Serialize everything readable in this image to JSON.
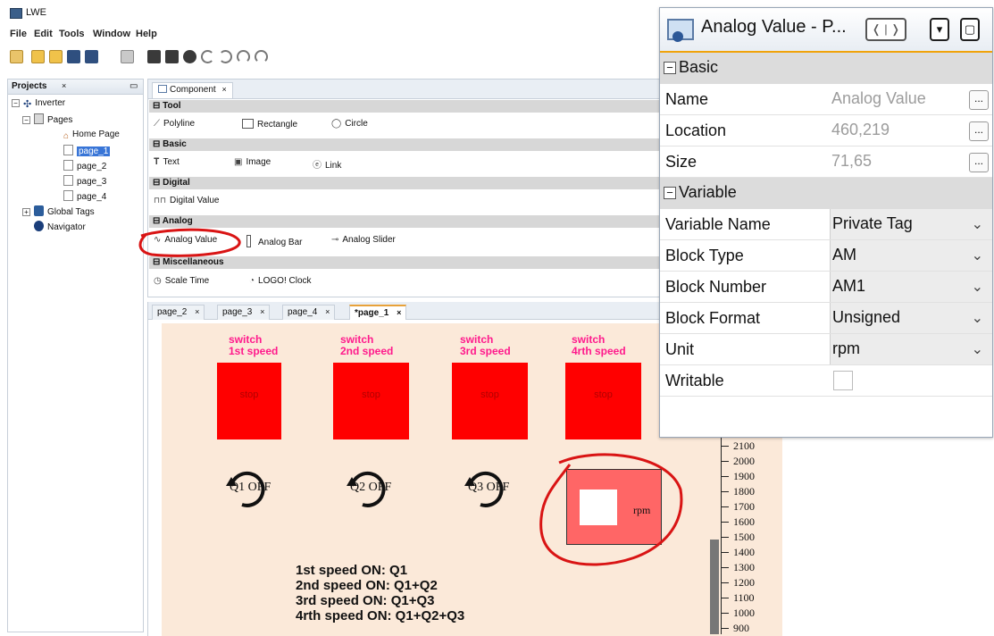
{
  "app": {
    "title": "LWE"
  },
  "menu": [
    "File",
    "Edit",
    "Tools",
    "Window",
    "Help"
  ],
  "projects": {
    "tab_label": "Projects",
    "tree": {
      "root": "Inverter",
      "pages_label": "Pages",
      "home": "Home Page",
      "pages": [
        "page_1",
        "page_2",
        "page_3",
        "page_4"
      ],
      "global_tags": "Global Tags",
      "navigator": "Navigator"
    }
  },
  "component": {
    "tab_label": "Component",
    "sections": {
      "tool": "Tool",
      "basic": "Basic",
      "digital": "Digital",
      "analog": "Analog",
      "misc": "Miscellaneous"
    },
    "items": {
      "polyline": "Polyline",
      "rectangle": "Rectangle",
      "circle": "Circle",
      "text": "Text",
      "image": "Image",
      "link": "Link",
      "digital_value": "Digital Value",
      "analog_value": "Analog Value",
      "analog_bar": "Analog Bar",
      "analog_slider": "Analog Slider",
      "scale_time": "Scale Time",
      "logo_clock": "LOGO! Clock"
    }
  },
  "editor": {
    "tabs": [
      "page_2",
      "page_3",
      "page_4",
      "*page_1"
    ],
    "switches": [
      {
        "line1": "switch",
        "line2": "1st speed",
        "button": "stop",
        "knob": "Q1 OFF"
      },
      {
        "line1": "switch",
        "line2": "2nd speed",
        "button": "stop",
        "knob": "Q2 OFF"
      },
      {
        "line1": "switch",
        "line2": "3rd speed",
        "button": "stop",
        "knob": "Q3 OFF"
      },
      {
        "line1": "switch",
        "line2": "4rth speed",
        "button": "stop"
      }
    ],
    "analog_unit": "rpm",
    "description": [
      "1st speed ON: Q1",
      "2nd speed ON: Q1+Q2",
      "3rd speed ON: Q1+Q3",
      "4rth speed ON: Q1+Q2+Q3"
    ],
    "gauge_ticks": [
      "2100",
      "2000",
      "1900",
      "1800",
      "1700",
      "1600",
      "1500",
      "1400",
      "1300",
      "1200",
      "1100",
      "1000",
      "900"
    ]
  },
  "properties": {
    "title": "Analog Value - P...",
    "groups": {
      "basic": "Basic",
      "variable": "Variable"
    },
    "basic": [
      {
        "key": "Name",
        "value": "Analog Value"
      },
      {
        "key": "Location",
        "value": "460,219"
      },
      {
        "key": "Size",
        "value": "71,65"
      }
    ],
    "variable": [
      {
        "key": "Variable Name",
        "value": "Private Tag"
      },
      {
        "key": "Block Type",
        "value": "AM"
      },
      {
        "key": "Block Number",
        "value": "AM1"
      },
      {
        "key": "Block Format",
        "value": "Unsigned"
      },
      {
        "key": "Unit",
        "value": "rpm"
      },
      {
        "key": "Writable",
        "value": ""
      }
    ]
  },
  "colors": {
    "annotation": "#d91414",
    "stop_button": "#ff0000",
    "switch_label": "#ff1a8c",
    "canvas": "#fbe9d9",
    "selection": "#3875d7"
  }
}
